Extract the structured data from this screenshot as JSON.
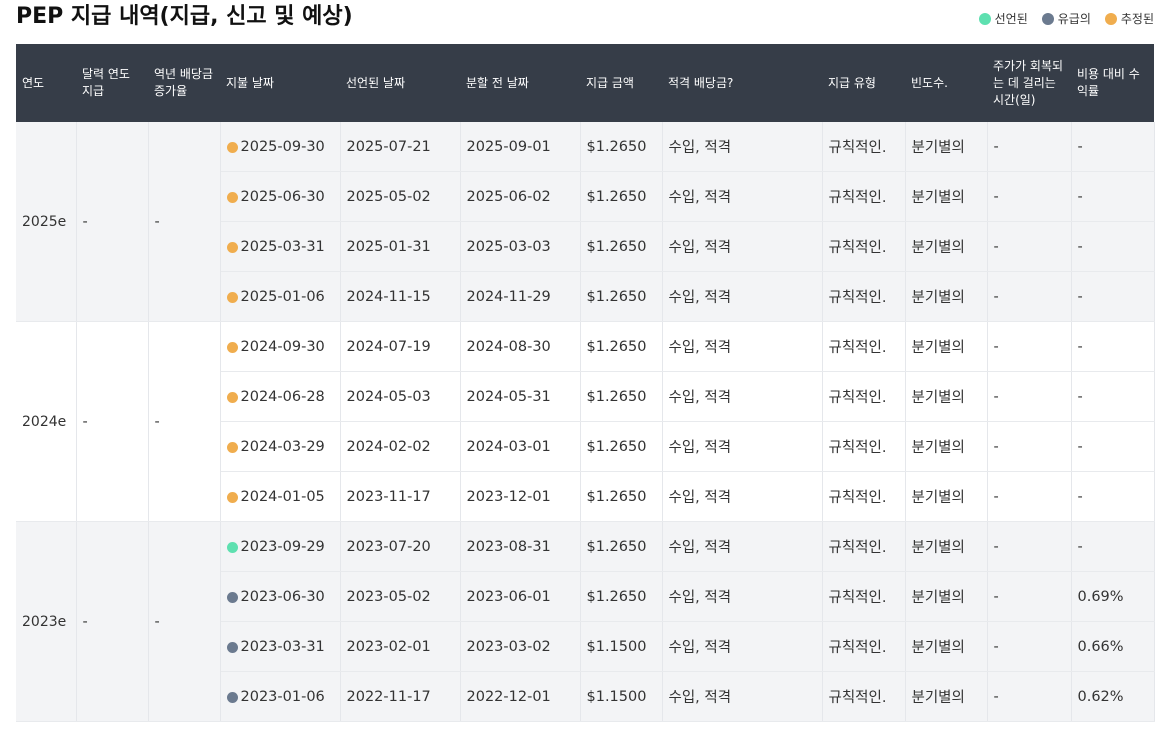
{
  "page": {
    "title": "PEP 지급 내역(지급, 신고 및 예상)"
  },
  "legend": [
    {
      "label": "선언된",
      "color": "#5ee0b0"
    },
    {
      "label": "유급의",
      "color": "#6b7a8f"
    },
    {
      "label": "추정된",
      "color": "#f0ad4e"
    }
  ],
  "table": {
    "headers": [
      "연도",
      "달력 연도 지급",
      "역년 배당금 증가율",
      "지불 날짜",
      "선언된 날짜",
      "분할 전 날짜",
      "지급 금액",
      "적격 배당금?",
      "지급 유형",
      "빈도수.",
      "주가가 회복되는 데 걸리는 시간(일)",
      "비용 대비 수익률"
    ],
    "groups": [
      {
        "year": "2025e",
        "annual": "-",
        "growth": "-",
        "rows": [
          {
            "status": "estimated",
            "pay_date": "2025-09-30",
            "declared": "2025-07-21",
            "ex_date": "2025-09-01",
            "amount": "$1.2650",
            "qualified": "수입, 적격",
            "type": "규칙적인.",
            "frequency": "분기별의",
            "recovery": "-",
            "yield": "-"
          },
          {
            "status": "estimated",
            "pay_date": "2025-06-30",
            "declared": "2025-05-02",
            "ex_date": "2025-06-02",
            "amount": "$1.2650",
            "qualified": "수입, 적격",
            "type": "규칙적인.",
            "frequency": "분기별의",
            "recovery": "-",
            "yield": "-"
          },
          {
            "status": "estimated",
            "pay_date": "2025-03-31",
            "declared": "2025-01-31",
            "ex_date": "2025-03-03",
            "amount": "$1.2650",
            "qualified": "수입, 적격",
            "type": "규칙적인.",
            "frequency": "분기별의",
            "recovery": "-",
            "yield": "-"
          },
          {
            "status": "estimated",
            "pay_date": "2025-01-06",
            "declared": "2024-11-15",
            "ex_date": "2024-11-29",
            "amount": "$1.2650",
            "qualified": "수입, 적격",
            "type": "규칙적인.",
            "frequency": "분기별의",
            "recovery": "-",
            "yield": "-"
          }
        ]
      },
      {
        "year": "2024e",
        "annual": "-",
        "growth": "-",
        "rows": [
          {
            "status": "estimated",
            "pay_date": "2024-09-30",
            "declared": "2024-07-19",
            "ex_date": "2024-08-30",
            "amount": "$1.2650",
            "qualified": "수입, 적격",
            "type": "규칙적인.",
            "frequency": "분기별의",
            "recovery": "-",
            "yield": "-"
          },
          {
            "status": "estimated",
            "pay_date": "2024-06-28",
            "declared": "2024-05-03",
            "ex_date": "2024-05-31",
            "amount": "$1.2650",
            "qualified": "수입, 적격",
            "type": "규칙적인.",
            "frequency": "분기별의",
            "recovery": "-",
            "yield": "-"
          },
          {
            "status": "estimated",
            "pay_date": "2024-03-29",
            "declared": "2024-02-02",
            "ex_date": "2024-03-01",
            "amount": "$1.2650",
            "qualified": "수입, 적격",
            "type": "규칙적인.",
            "frequency": "분기별의",
            "recovery": "-",
            "yield": "-"
          },
          {
            "status": "estimated",
            "pay_date": "2024-01-05",
            "declared": "2023-11-17",
            "ex_date": "2023-12-01",
            "amount": "$1.2650",
            "qualified": "수입, 적격",
            "type": "규칙적인.",
            "frequency": "분기별의",
            "recovery": "-",
            "yield": "-"
          }
        ]
      },
      {
        "year": "2023e",
        "annual": "-",
        "growth": "-",
        "rows": [
          {
            "status": "declared",
            "pay_date": "2023-09-29",
            "declared": "2023-07-20",
            "ex_date": "2023-08-31",
            "amount": "$1.2650",
            "qualified": "수입, 적격",
            "type": "규칙적인.",
            "frequency": "분기별의",
            "recovery": "-",
            "yield": "-"
          },
          {
            "status": "paid",
            "pay_date": "2023-06-30",
            "declared": "2023-05-02",
            "ex_date": "2023-06-01",
            "amount": "$1.2650",
            "qualified": "수입, 적격",
            "type": "규칙적인.",
            "frequency": "분기별의",
            "recovery": "-",
            "yield": "0.69%"
          },
          {
            "status": "paid",
            "pay_date": "2023-03-31",
            "declared": "2023-02-01",
            "ex_date": "2023-03-02",
            "amount": "$1.1500",
            "qualified": "수입, 적격",
            "type": "규칙적인.",
            "frequency": "분기별의",
            "recovery": "-",
            "yield": "0.66%"
          },
          {
            "status": "paid",
            "pay_date": "2023-01-06",
            "declared": "2022-11-17",
            "ex_date": "2022-12-01",
            "amount": "$1.1500",
            "qualified": "수입, 적격",
            "type": "규칙적인.",
            "frequency": "분기별의",
            "recovery": "-",
            "yield": "0.62%"
          }
        ]
      }
    ]
  },
  "status_colors": {
    "declared": "#5ee0b0",
    "paid": "#6b7a8f",
    "estimated": "#f0ad4e"
  }
}
